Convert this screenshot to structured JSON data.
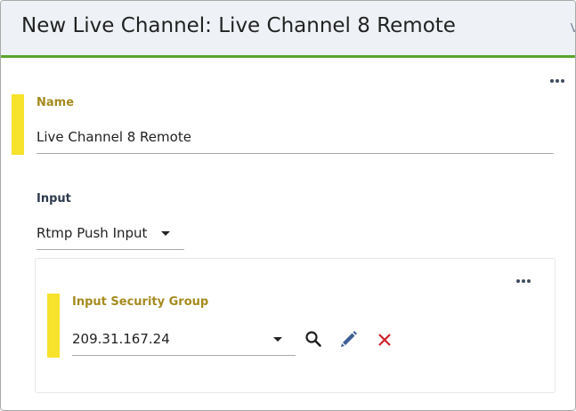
{
  "header": {
    "title": "New Live Channel: Live Channel 8 Remote"
  },
  "name_field": {
    "label": "Name",
    "value": "Live Channel 8 Remote"
  },
  "input_field": {
    "label": "Input",
    "selected": "Rtmp Push Input"
  },
  "security_group": {
    "label": "Input Security Group",
    "selected": "209.31.167.24",
    "actions": [
      "search-icon",
      "edit-icon",
      "remove-icon"
    ]
  },
  "colors": {
    "header_rule": "#5aa52e",
    "required_marker": "#f7e22c",
    "label_gold": "#a48b1f",
    "edit_icon": "#3d5f94",
    "remove_icon": "#d0212b"
  }
}
